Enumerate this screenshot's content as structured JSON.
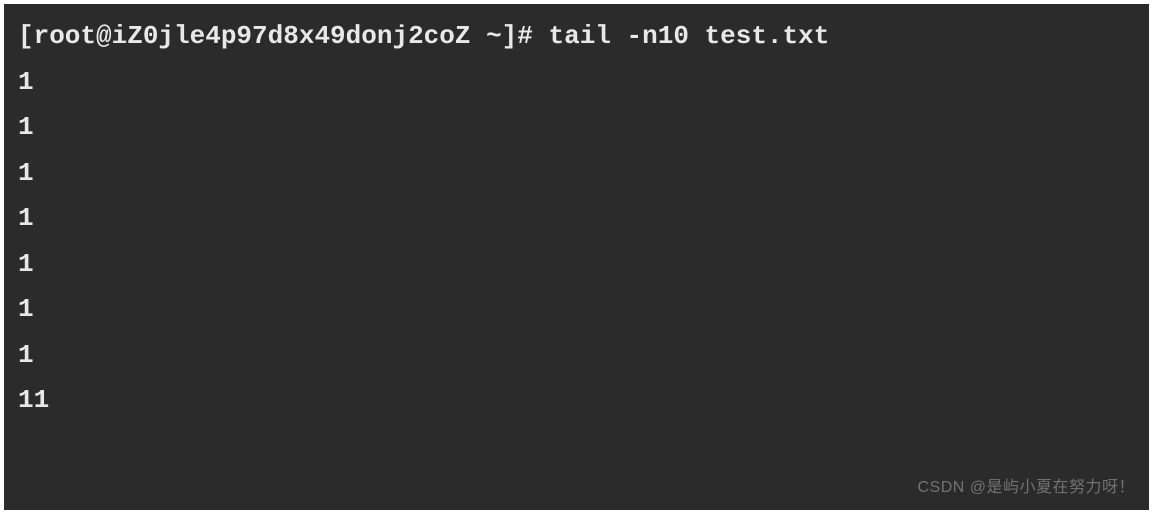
{
  "terminal": {
    "prompt": "[root@iZ0jle4p97d8x49donj2coZ ~]# ",
    "command": "tail -n10 test.txt",
    "output": [
      "1",
      "1",
      "1",
      "1",
      "1",
      "1",
      "1",
      "11"
    ]
  },
  "watermark": "CSDN @是屿小夏在努力呀！"
}
